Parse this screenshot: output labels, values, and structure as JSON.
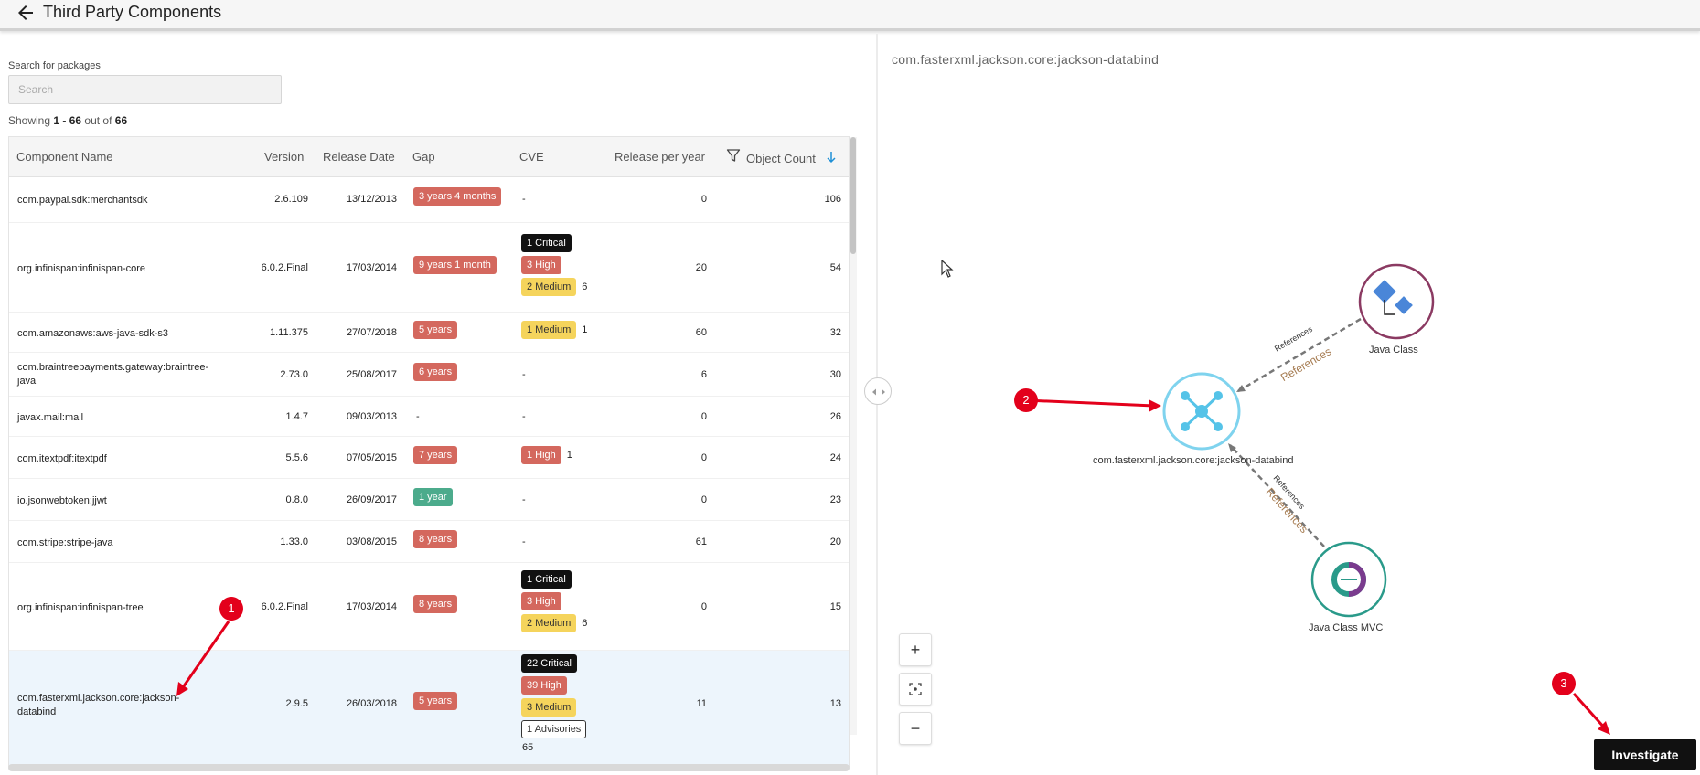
{
  "header": {
    "title": "Third Party Components"
  },
  "search": {
    "label": "Search for packages",
    "placeholder": "Search"
  },
  "showing": {
    "prefix": "Showing",
    "range": "1 - 66",
    "middle": "out of",
    "total": "66"
  },
  "table": {
    "columns": {
      "name": "Component Name",
      "version": "Version",
      "release_date": "Release Date",
      "gap": "Gap",
      "cve": "CVE",
      "release_per_year": "Release per year",
      "object_count": "Object Count"
    },
    "rows": [
      {
        "name": "com.paypal.sdk:merchantsdk",
        "version": "2.6.109",
        "release_date": "13/12/2013",
        "gap": "3 years 4 months",
        "cve_dash": "-",
        "release_per_year": "0",
        "object_count": "106"
      },
      {
        "name": "org.infinispan:infinispan-core",
        "version": "6.0.2.Final",
        "release_date": "17/03/2014",
        "gap": "9 years 1 month",
        "cve_critical": "1 Critical",
        "cve_high": "3 High",
        "cve_medium": "2 Medium",
        "cve_total": "6",
        "release_per_year": "20",
        "object_count": "54"
      },
      {
        "name": "com.amazonaws:aws-java-sdk-s3",
        "version": "1.11.375",
        "release_date": "27/07/2018",
        "gap": "5 years",
        "cve_medium": "1 Medium",
        "cve_total": "1",
        "release_per_year": "60",
        "object_count": "32"
      },
      {
        "name_line1": "com.braintreepayments.gateway:braintree-",
        "name_line2": "java",
        "version": "2.73.0",
        "release_date": "25/08/2017",
        "gap": "6 years",
        "cve_dash": "-",
        "release_per_year": "6",
        "object_count": "30"
      },
      {
        "name": "javax.mail:mail",
        "version": "1.4.7",
        "release_date": "09/03/2013",
        "gap_dash": "-",
        "cve_dash": "-",
        "release_per_year": "0",
        "object_count": "26"
      },
      {
        "name": "com.itextpdf:itextpdf",
        "version": "5.5.6",
        "release_date": "07/05/2015",
        "gap": "7 years",
        "cve_high": "1 High",
        "cve_total": "1",
        "release_per_year": "0",
        "object_count": "24"
      },
      {
        "name": "io.jsonwebtoken:jjwt",
        "version": "0.8.0",
        "release_date": "26/09/2017",
        "gap": "1 year",
        "cve_dash": "-",
        "release_per_year": "0",
        "object_count": "23"
      },
      {
        "name": "com.stripe:stripe-java",
        "version": "1.33.0",
        "release_date": "03/08/2015",
        "gap": "8 years",
        "cve_dash": "-",
        "release_per_year": "61",
        "object_count": "20"
      },
      {
        "name": "org.infinispan:infinispan-tree",
        "version": "6.0.2.Final",
        "release_date": "17/03/2014",
        "gap": "8 years",
        "cve_critical": "1 Critical",
        "cve_high": "3 High",
        "cve_medium": "2 Medium",
        "cve_total": "6",
        "release_per_year": "0",
        "object_count": "15"
      },
      {
        "name_line1": "com.fasterxml.jackson.core:jackson-",
        "name_line2": "databind",
        "version": "2.9.5",
        "release_date": "26/03/2018",
        "gap": "5 years",
        "cve_critical": "22 Critical",
        "cve_high": "39 High",
        "cve_medium": "3 Medium",
        "cve_advisories": "1 Advisories",
        "cve_total": "65",
        "release_per_year": "11",
        "object_count": "13"
      }
    ]
  },
  "graph": {
    "title": "com.fasterxml.jackson.core:jackson-databind",
    "center_node": "com.fasterxml.jackson.core:jackson-databind",
    "node_java_class": "Java Class",
    "node_java_class_mvc": "Java Class MVC",
    "edge_label": "References",
    "colors": {
      "center": "#7fd3ee",
      "java_class": "#8b3a62",
      "java_class_mvc": "#2a9a8a"
    }
  },
  "zoom": {
    "in": "+",
    "out": "−"
  },
  "actions": {
    "investigate": "Investigate"
  },
  "callouts": [
    "1",
    "2",
    "3"
  ]
}
